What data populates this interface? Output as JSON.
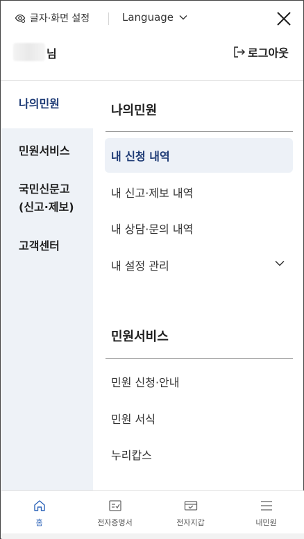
{
  "header": {
    "settings_label": "글자·화면 설정",
    "language_label": "Language",
    "username_suffix": "님",
    "logout_label": "로그아웃"
  },
  "left_nav": {
    "items": [
      {
        "label": "나의민원",
        "active": true
      },
      {
        "label": "민원서비스",
        "active": false
      },
      {
        "label": "국민신문고\n(신고·제보)",
        "active": false
      },
      {
        "label": "고객센터",
        "active": false
      }
    ]
  },
  "sections": [
    {
      "title": "나의민원",
      "items": [
        {
          "label": "내 신청 내역",
          "active": true
        },
        {
          "label": "내 신고·제보 내역",
          "active": false
        },
        {
          "label": "내 상담·문의 내역",
          "active": false
        },
        {
          "label": "내 설정 관리",
          "active": false,
          "expandable": true
        }
      ]
    },
    {
      "title": "민원서비스",
      "items": [
        {
          "label": "민원 신청·안내"
        },
        {
          "label": "민원 서식"
        },
        {
          "label": "누리캅스"
        }
      ]
    }
  ],
  "bottom_nav": [
    {
      "label": "홈",
      "icon": "home-icon",
      "active": true
    },
    {
      "label": "전자증명서",
      "icon": "certificate-icon",
      "active": false
    },
    {
      "label": "전자지갑",
      "icon": "wallet-icon",
      "active": false
    },
    {
      "label": "내민원",
      "icon": "menu-icon",
      "active": false
    }
  ],
  "colors": {
    "accent": "#1d3a75",
    "active_bg": "#edf1f7",
    "sidebar_bg": "#eef2f7",
    "bottom_active": "#2c63b8"
  }
}
